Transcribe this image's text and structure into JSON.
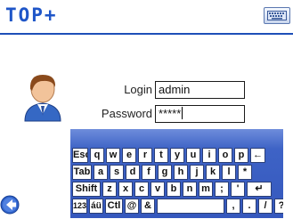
{
  "app": {
    "title": "TOP+"
  },
  "header": {
    "keyboard_icon": "keyboard-icon"
  },
  "login": {
    "avatar_icon": "user-avatar-icon",
    "login_label": "Login",
    "login_value": "admin",
    "password_label": "Password",
    "password_value": "*****"
  },
  "keyboard": {
    "rows": [
      [
        "Esc",
        "q",
        "w",
        "e",
        "r",
        "t",
        "y",
        "u",
        "i",
        "o",
        "p",
        "←"
      ],
      [
        "Tab",
        "a",
        "s",
        "d",
        "f",
        "g",
        "h",
        "j",
        "k",
        "l",
        "*"
      ],
      [
        "Shift",
        "z",
        "x",
        "c",
        "v",
        "b",
        "n",
        "m",
        ";",
        "'",
        "↵"
      ],
      [
        "123",
        "áü",
        "Ctl",
        "@",
        "&",
        " ",
        ",",
        ".",
        "/",
        "?"
      ]
    ]
  },
  "footer": {
    "back_icon": "back-arrow-icon"
  }
}
